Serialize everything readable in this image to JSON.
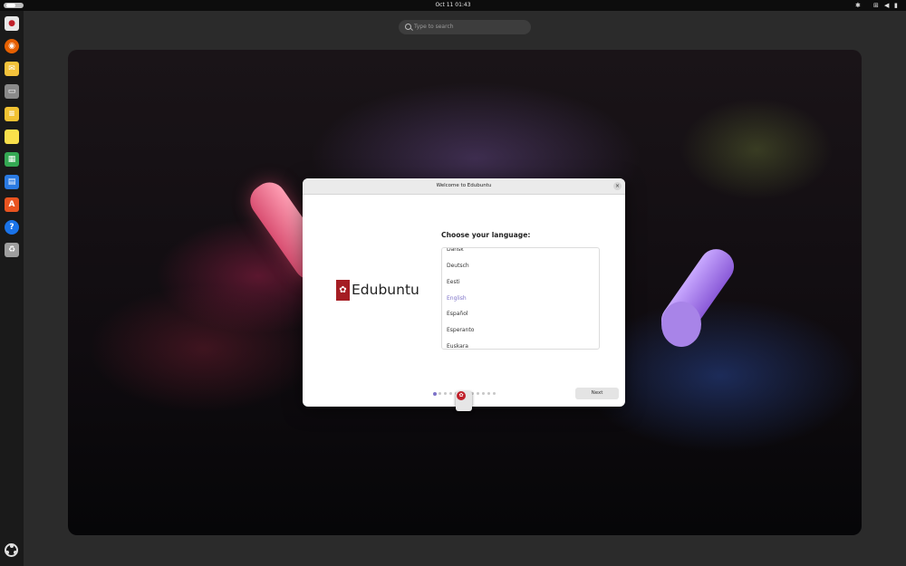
{
  "topbar": {
    "clock": "Oct 11  01:43",
    "tray_icons": [
      "bluetooth-icon",
      "network-icon",
      "volume-icon",
      "battery-icon"
    ]
  },
  "search": {
    "placeholder": "Type to search"
  },
  "dock": {
    "items": [
      {
        "name": "edubuntu-installer-icon",
        "color": "#e8e8e8"
      },
      {
        "name": "firefox-icon",
        "color": "#e66000"
      },
      {
        "name": "mail-icon",
        "color": "#f3c23b"
      },
      {
        "name": "files-icon",
        "color": "#8a8a8a"
      },
      {
        "name": "calculator-icon",
        "color": "#f1c232"
      },
      {
        "name": "notes-icon",
        "color": "#f9e04b"
      },
      {
        "name": "spreadsheet-icon",
        "color": "#34a853"
      },
      {
        "name": "writer-icon",
        "color": "#2a7ae2"
      },
      {
        "name": "software-center-icon",
        "color": "#e95420"
      },
      {
        "name": "help-icon",
        "color": "#1a73e8"
      },
      {
        "name": "trash-icon",
        "color": "#9e9e9e"
      }
    ]
  },
  "dialog": {
    "title": "Welcome to Edubuntu",
    "brand": "Edubuntu",
    "heading": "Choose your language:",
    "languages": [
      "Dansk",
      "Deutsch",
      "Eesti",
      "English",
      "Español",
      "Esperanto",
      "Euskara"
    ],
    "selected_language": "English",
    "next_label": "Next",
    "steps_total": 12,
    "step_current": 1
  },
  "colors": {
    "accent": "#7d72c8",
    "brand": "#a51d23"
  }
}
